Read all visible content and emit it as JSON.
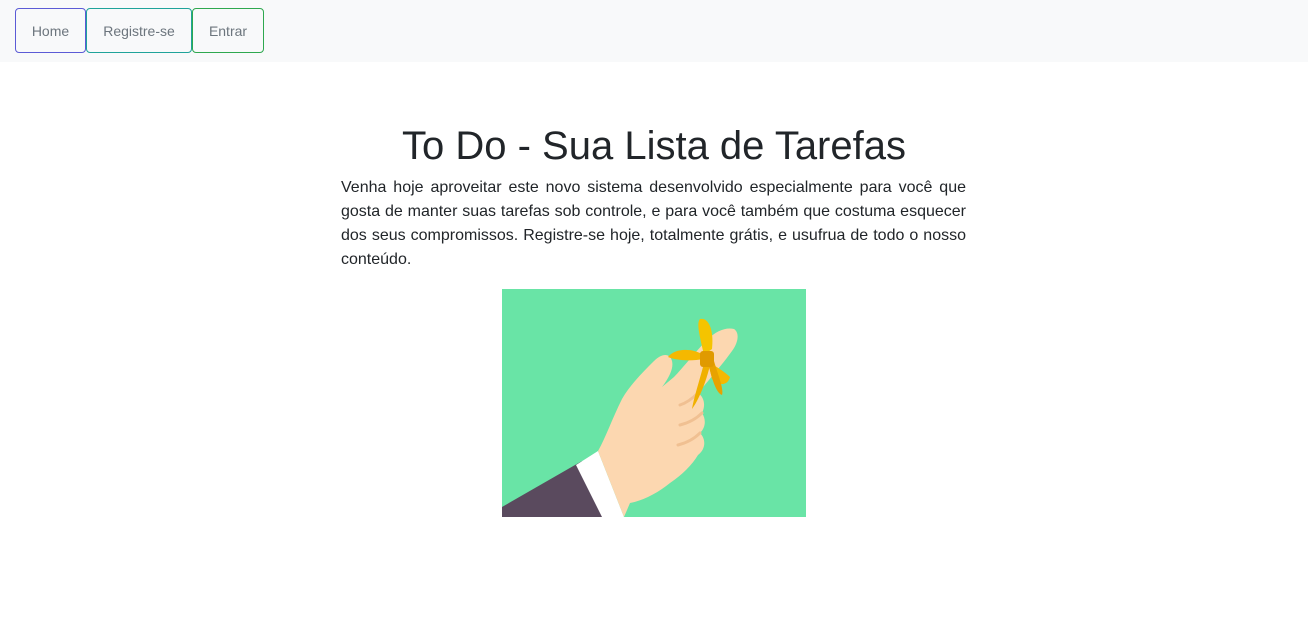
{
  "navbar": {
    "items": [
      {
        "label": "Home"
      },
      {
        "label": "Registre-se"
      },
      {
        "label": "Entrar"
      }
    ]
  },
  "main": {
    "title": "To Do - Sua Lista de Tarefas",
    "intro": "Venha hoje aproveitar este novo sistema desenvolvido especialmente para você que gosta de manter suas tarefas sob controle, e para você também que costuma esquecer dos seus compromissos. Registre-se hoje, totalmente grátis, e usufrua de todo o nosso conteúdo.",
    "illustration": {
      "icon": "hand-with-ribbon-reminder-icon",
      "colors": {
        "background": "#69e4a6",
        "skin": "#fcd7b0",
        "ribbon": "#f5b800",
        "sleeve": "#5a4a5e"
      }
    }
  }
}
